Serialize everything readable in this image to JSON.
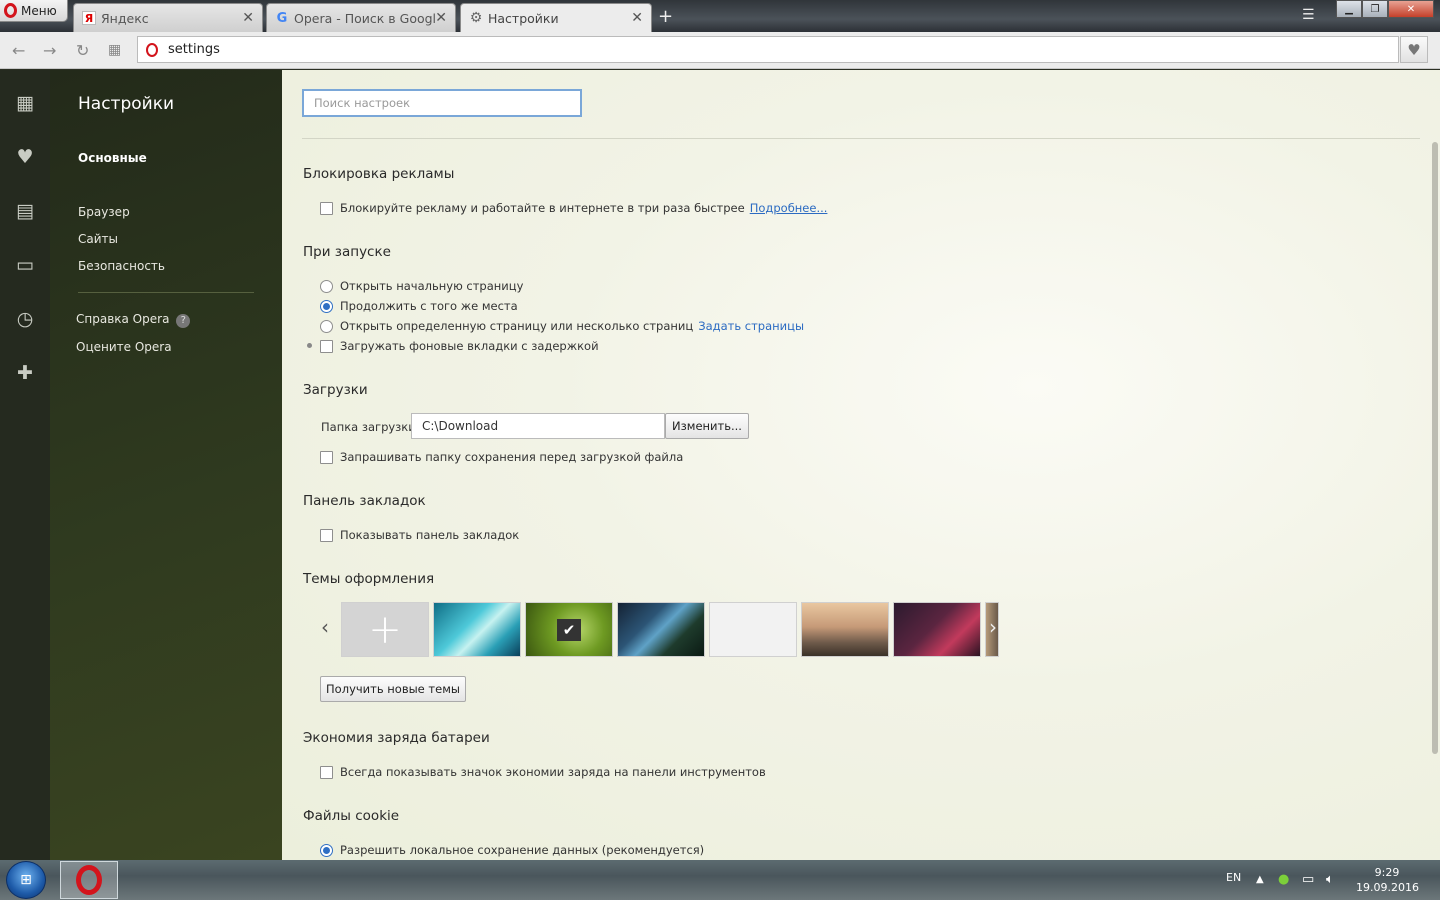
{
  "browser": {
    "menu_label": "Меню",
    "tabs": [
      {
        "title": "Яндекс",
        "favicon": "Я"
      },
      {
        "title": "Opera - Поиск в Google",
        "favicon": "G"
      },
      {
        "title": "Настройки",
        "favicon": "gear"
      }
    ],
    "address": "settings"
  },
  "sidebar": {
    "title": "Настройки",
    "items": [
      "Основные",
      "Браузер",
      "Сайты",
      "Безопасность"
    ],
    "help": "Справка Opera",
    "rate": "Оцените Opera"
  },
  "search": {
    "placeholder": "Поиск настроек"
  },
  "sections": {
    "adblock": {
      "title": "Блокировка рекламы",
      "checkbox": "Блокируйте рекламу и работайте в интернете в три раза быстрее",
      "link": "Подробнее..."
    },
    "startup": {
      "title": "При запуске",
      "opt1": "Открыть начальную страницу",
      "opt2": "Продолжить с того же места",
      "opt3": "Открыть определенную страницу или несколько страниц",
      "opt3_link": "Задать страницы",
      "delay": "Загружать фоновые вкладки с задержкой"
    },
    "downloads": {
      "title": "Загрузки",
      "folder_label": "Папка загрузки:",
      "folder_value": "C:\\Download",
      "change_button": "Изменить...",
      "ask": "Запрашивать папку сохранения перед загрузкой файла"
    },
    "bookmarks": {
      "title": "Панель закладок",
      "show": "Показывать панель закладок"
    },
    "themes": {
      "title": "Темы оформления",
      "get_button": "Получить новые темы"
    },
    "battery": {
      "title": "Экономия заряда батареи",
      "show_icon": "Всегда показывать значок экономии заряда на панели инструментов"
    },
    "cookies": {
      "title": "Файлы cookie",
      "allow": "Разрешить локальное сохранение данных (рекомендуется)"
    }
  },
  "taskbar": {
    "lang": "EN",
    "time": "9:29",
    "date": "19.09.2016"
  }
}
